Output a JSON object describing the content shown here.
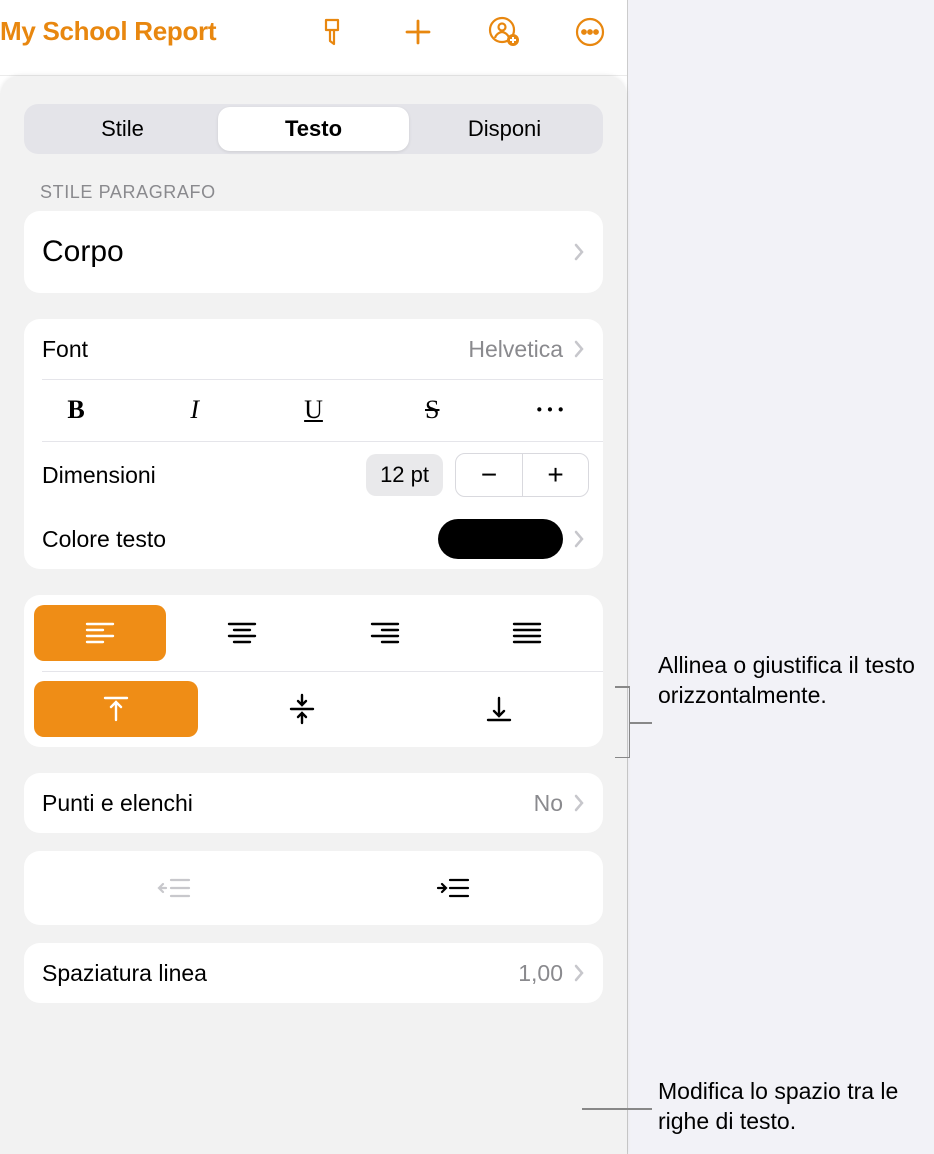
{
  "toolbar": {
    "doc_title": "My School Report"
  },
  "tabs": {
    "style": "Stile",
    "text": "Testo",
    "arrange": "Disponi"
  },
  "paragraph": {
    "header": "STILE PARAGRAFO",
    "style_name": "Corpo"
  },
  "font": {
    "label": "Font",
    "value": "Helvetica",
    "size_label": "Dimensioni",
    "size_value": "12 pt",
    "color_label": "Colore testo"
  },
  "bullets": {
    "label": "Punti e elenchi",
    "value": "No"
  },
  "spacing": {
    "label": "Spaziatura linea",
    "value": "1,00"
  },
  "annotations": {
    "align": "Allinea o giustifica il testo orizzontalmente.",
    "line_spacing": "Modifica lo spazio tra le righe di testo."
  },
  "colors": {
    "accent": "#ef8d16"
  }
}
